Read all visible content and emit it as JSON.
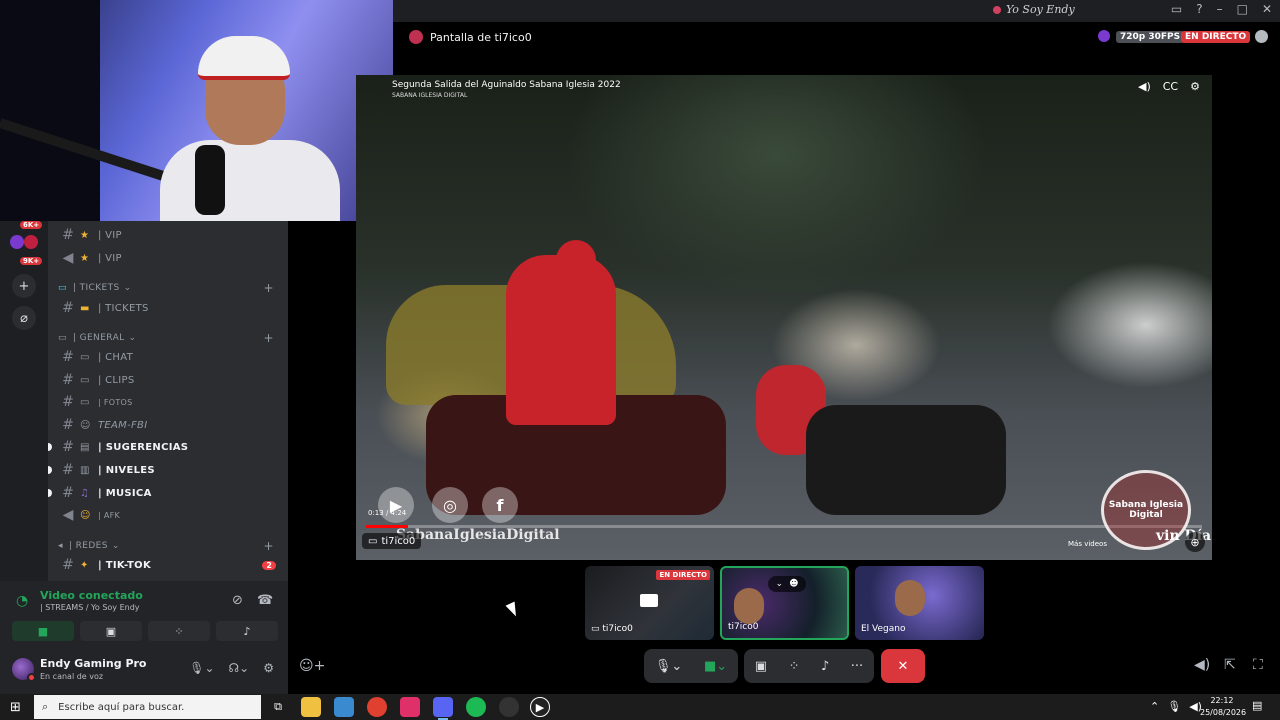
{
  "window": {
    "title": "Yo Soy Endy"
  },
  "stream": {
    "title": "Pantalla de ti7ico0",
    "quality": "720p 30FPS",
    "live_badge": "EN DIRECTO",
    "viewer_name": "ti7ico0"
  },
  "video": {
    "title": "Segunda Salida del Aguinaldo Sabana Iglesia 2022",
    "channel": "SABANA IGLESIA DIGITAL",
    "time": "0:13 / 4:24",
    "progress": 0.05,
    "watermark": "SabanaIglesiaDigital",
    "logo_text": "Sabana Iglesia Digital",
    "logo_extra": "vin Día",
    "more_videos": "Más videos"
  },
  "rail": {
    "badges": [
      "6K+",
      "9K+"
    ]
  },
  "channels": {
    "items": [
      {
        "type": "text",
        "emoji": "★",
        "name": "| VIP",
        "style": "normal"
      },
      {
        "type": "voice",
        "emoji": "★",
        "name": "| VIP",
        "style": "normal"
      },
      {
        "type": "category",
        "emoji": "▭",
        "name": "| TICKETS"
      },
      {
        "type": "text",
        "emoji": "▬",
        "name": "| TICKETS",
        "style": "normal"
      },
      {
        "type": "category",
        "emoji": "▭",
        "name": "| GENERAL"
      },
      {
        "type": "text",
        "emoji": "▭",
        "name": "| CHAT",
        "style": "normal"
      },
      {
        "type": "text",
        "emoji": "▭",
        "name": "| CLIPS",
        "style": "normal"
      },
      {
        "type": "text",
        "emoji": "▭",
        "name": "| FOTOS",
        "style": "normal"
      },
      {
        "type": "text",
        "emoji": "",
        "name": "TEAM-FBI",
        "style": "italic"
      },
      {
        "type": "text",
        "emoji": "▤",
        "name": "| SUGERENCIAS",
        "style": "bold"
      },
      {
        "type": "text",
        "emoji": "▥",
        "name": "| NIVELES",
        "style": "bold"
      },
      {
        "type": "text",
        "emoji": "♫",
        "name": "| MUSICA",
        "style": "bold"
      },
      {
        "type": "voice",
        "emoji": "☺",
        "name": "| AFK",
        "style": "normal"
      },
      {
        "type": "category",
        "emoji": "◂",
        "name": "| REDES"
      },
      {
        "type": "text",
        "emoji": "✦",
        "name": "| TIK-TOK",
        "style": "bold",
        "mentions": "2"
      }
    ]
  },
  "voice": {
    "status": "Video conectado",
    "channel": "| STREAMS / Yo Soy Endy"
  },
  "user": {
    "name": "Endy Gaming Pro",
    "status": "En canal de voz"
  },
  "tiles": [
    {
      "name": "ti7ico0",
      "badge": "EN DIRECTO"
    },
    {
      "name": "ti7ico0",
      "badge": ""
    },
    {
      "name": "El Vegano",
      "badge": ""
    }
  ],
  "taskbar": {
    "search_placeholder": "Escribe aquí para buscar.",
    "time": "22:12",
    "date": "25/08/2026"
  },
  "colors": {
    "accent_green": "#23a55a",
    "danger_red": "#da373c",
    "youtube_red": "#ff0000"
  }
}
